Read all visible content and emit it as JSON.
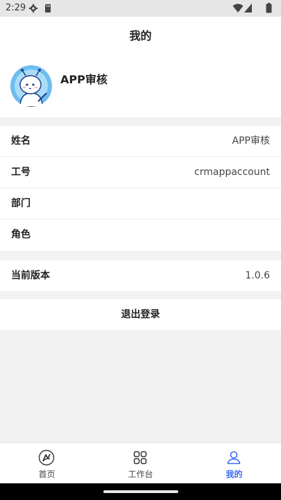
{
  "status_bar": {
    "time": "2:29",
    "icons": [
      "gear-icon",
      "sd-card-icon",
      "wifi-icon",
      "signal-icon",
      "battery-icon"
    ]
  },
  "header": {
    "title": "我的"
  },
  "profile": {
    "name": "APP审核",
    "avatar": "cartoon-avatar"
  },
  "info": {
    "name_label": "姓名",
    "name_value": "APP审核",
    "id_label": "工号",
    "id_value": "crmappaccount",
    "dept_label": "部门",
    "dept_value": "",
    "role_label": "角色",
    "role_value": ""
  },
  "version": {
    "label": "当前版本",
    "value": "1.0.6"
  },
  "logout": {
    "label": "退出登录"
  },
  "tabs": [
    {
      "label": "首页",
      "icon": "home-logo-icon",
      "active": false
    },
    {
      "label": "工作台",
      "icon": "grid-icon",
      "active": false
    },
    {
      "label": "我的",
      "icon": "person-icon",
      "active": true
    }
  ],
  "colors": {
    "accent": "#3a6cf0",
    "background": "#f2f2f2",
    "card": "#ffffff",
    "status_bar": "#e6e6e6"
  }
}
